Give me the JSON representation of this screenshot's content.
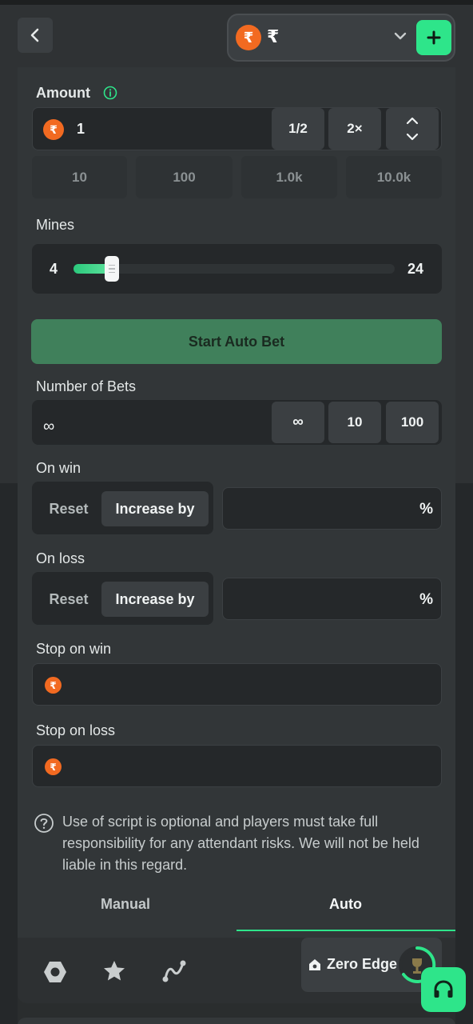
{
  "header": {
    "currency_symbol": "₹",
    "coin_glyph": "₹",
    "icons": {
      "back": "chevron-left-icon",
      "dropdown": "chevron-down-icon",
      "add": "plus-icon"
    }
  },
  "amount": {
    "label": "Amount",
    "value": "1",
    "half_label": "1/2",
    "double_label": "2×",
    "quick_values": [
      "10",
      "100",
      "1.0k",
      "10.0k"
    ]
  },
  "mines": {
    "label": "Mines",
    "min": "4",
    "max": "24",
    "level_fraction": 0.12
  },
  "start_button": "Start Auto Bet",
  "number_of_bets": {
    "label": "Number of Bets",
    "value": "∞",
    "options": [
      "∞",
      "10",
      "100"
    ]
  },
  "on_win": {
    "label": "On win",
    "reset": "Reset",
    "increase": "Increase by",
    "unit": "%"
  },
  "on_loss": {
    "label": "On loss",
    "reset": "Reset",
    "increase": "Increase by",
    "unit": "%"
  },
  "stop_on_win": {
    "label": "Stop on win"
  },
  "stop_on_loss": {
    "label": "Stop on loss"
  },
  "disclaimer": "Use of script is optional and players must take full responsibility for any attendant risks. We will not be held liable in this regard.",
  "tabs": {
    "manual": "Manual",
    "auto": "Auto",
    "active": "Auto"
  },
  "footer": {
    "zero_edge": "Zero Edge"
  },
  "colors": {
    "accent": "#2ee58a",
    "coin": "#f26a21",
    "start_button": "#40805b"
  }
}
